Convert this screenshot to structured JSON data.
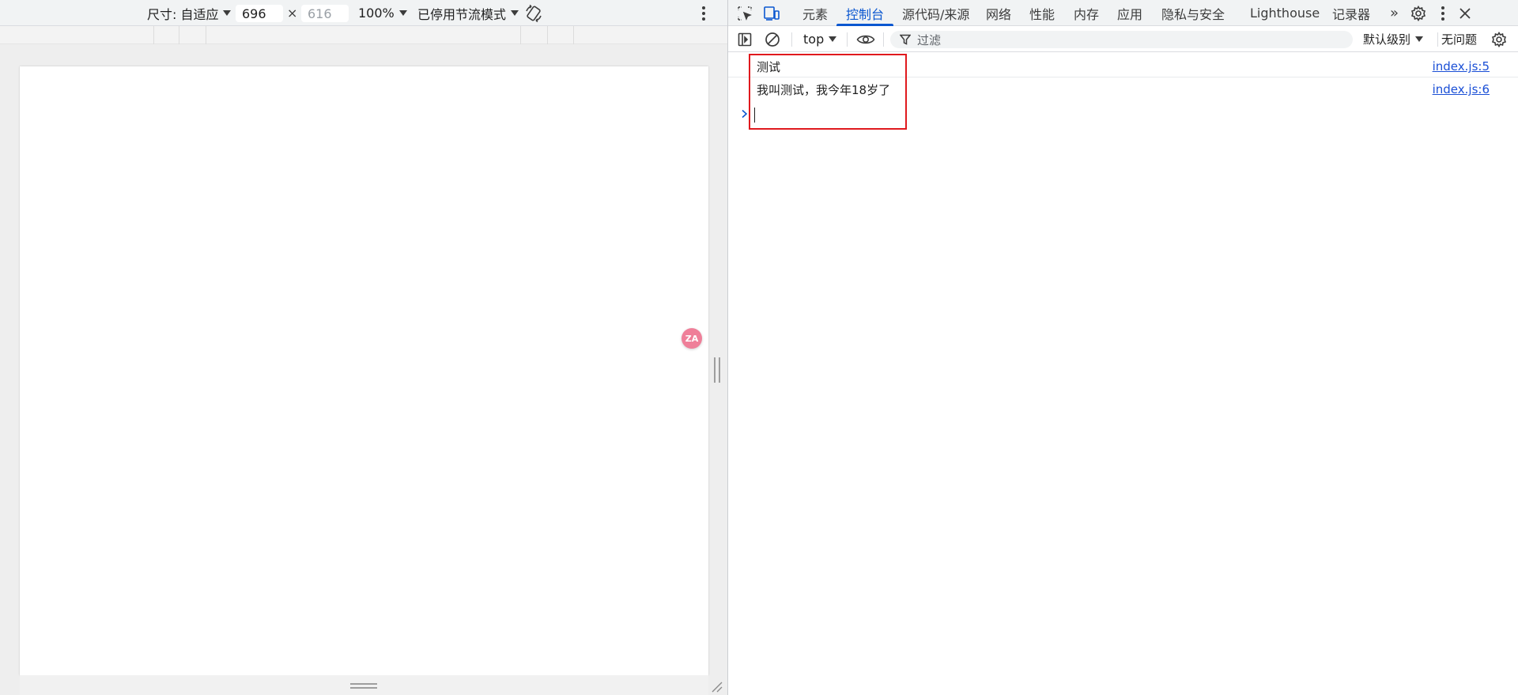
{
  "emulation": {
    "size_label": "尺寸: 自适应",
    "width": "696",
    "height": "616",
    "times": "×",
    "zoom": "100%",
    "throttle": "已停用节流模式",
    "translate_badge": "ZA"
  },
  "devtools": {
    "tabs": [
      {
        "label": "元素"
      },
      {
        "label": "控制台"
      },
      {
        "label": "源代码/来源"
      },
      {
        "label": "网络"
      },
      {
        "label": "性能"
      },
      {
        "label": "内存"
      },
      {
        "label": "应用"
      },
      {
        "label": "隐私与安全"
      },
      {
        "label": "Lighthouse"
      },
      {
        "label": "记录器"
      }
    ],
    "active_tab": "控制台",
    "more_tabs": "»"
  },
  "console_bar": {
    "context": "top",
    "filter_placeholder": "过滤",
    "level": "默认级别",
    "issues": "无问题"
  },
  "console": {
    "messages": [
      {
        "text": "测试",
        "source": "index.js:5"
      },
      {
        "text": "我叫测试，我今年18岁了",
        "source": "index.js:6"
      }
    ]
  },
  "colors": {
    "accent": "#0b57d0",
    "link": "#1a4fd6",
    "highlight": "#e0191e",
    "badge": "#ef7f99"
  }
}
